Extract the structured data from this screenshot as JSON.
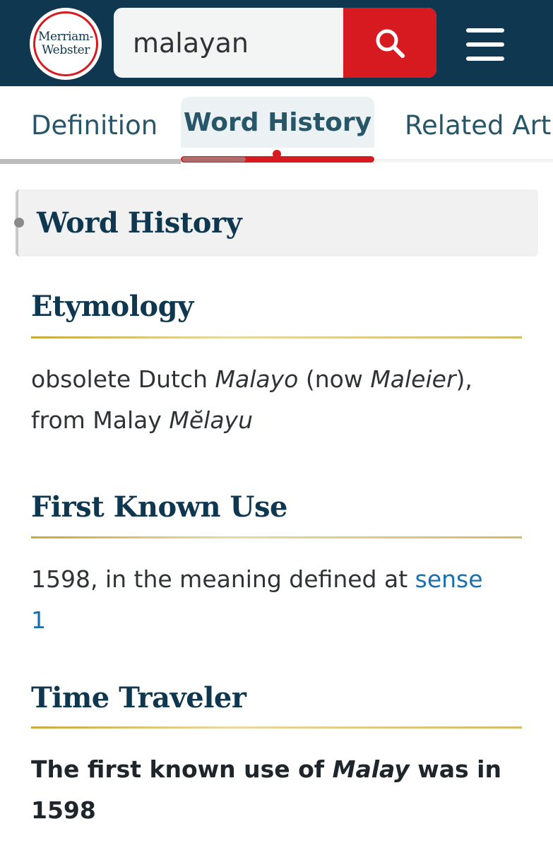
{
  "header": {
    "logo_line1": "Merriam-",
    "logo_line2": "Webster",
    "search_value": "malayan",
    "colors": {
      "header_bg": "#0f3850",
      "accent": "#d71920"
    },
    "search_icon": "search-icon",
    "menu_icon": "hamburger-menu-icon"
  },
  "tabs": {
    "definition": "Definition",
    "word_history": "Word History",
    "related": "Related Artic"
  },
  "word_history": {
    "title": "Word History",
    "etymology": {
      "title": "Etymology",
      "p1": "obsolete Dutch ",
      "i1": "Malayo",
      "p2": " (now ",
      "i2": "Maleier",
      "p3": "),",
      "p4": "from Malay ",
      "i3": "Mĕlayu"
    },
    "first_known_use": {
      "title": "First Known Use",
      "text_prefix": "1598, in the meaning defined at ",
      "link_line1": "sense",
      "link_line2": "1"
    },
    "time_traveler": {
      "title": "Time Traveler",
      "t1": "The first known use of ",
      "i1": "Malay",
      "t2": " was in",
      "t3": "1598"
    }
  }
}
